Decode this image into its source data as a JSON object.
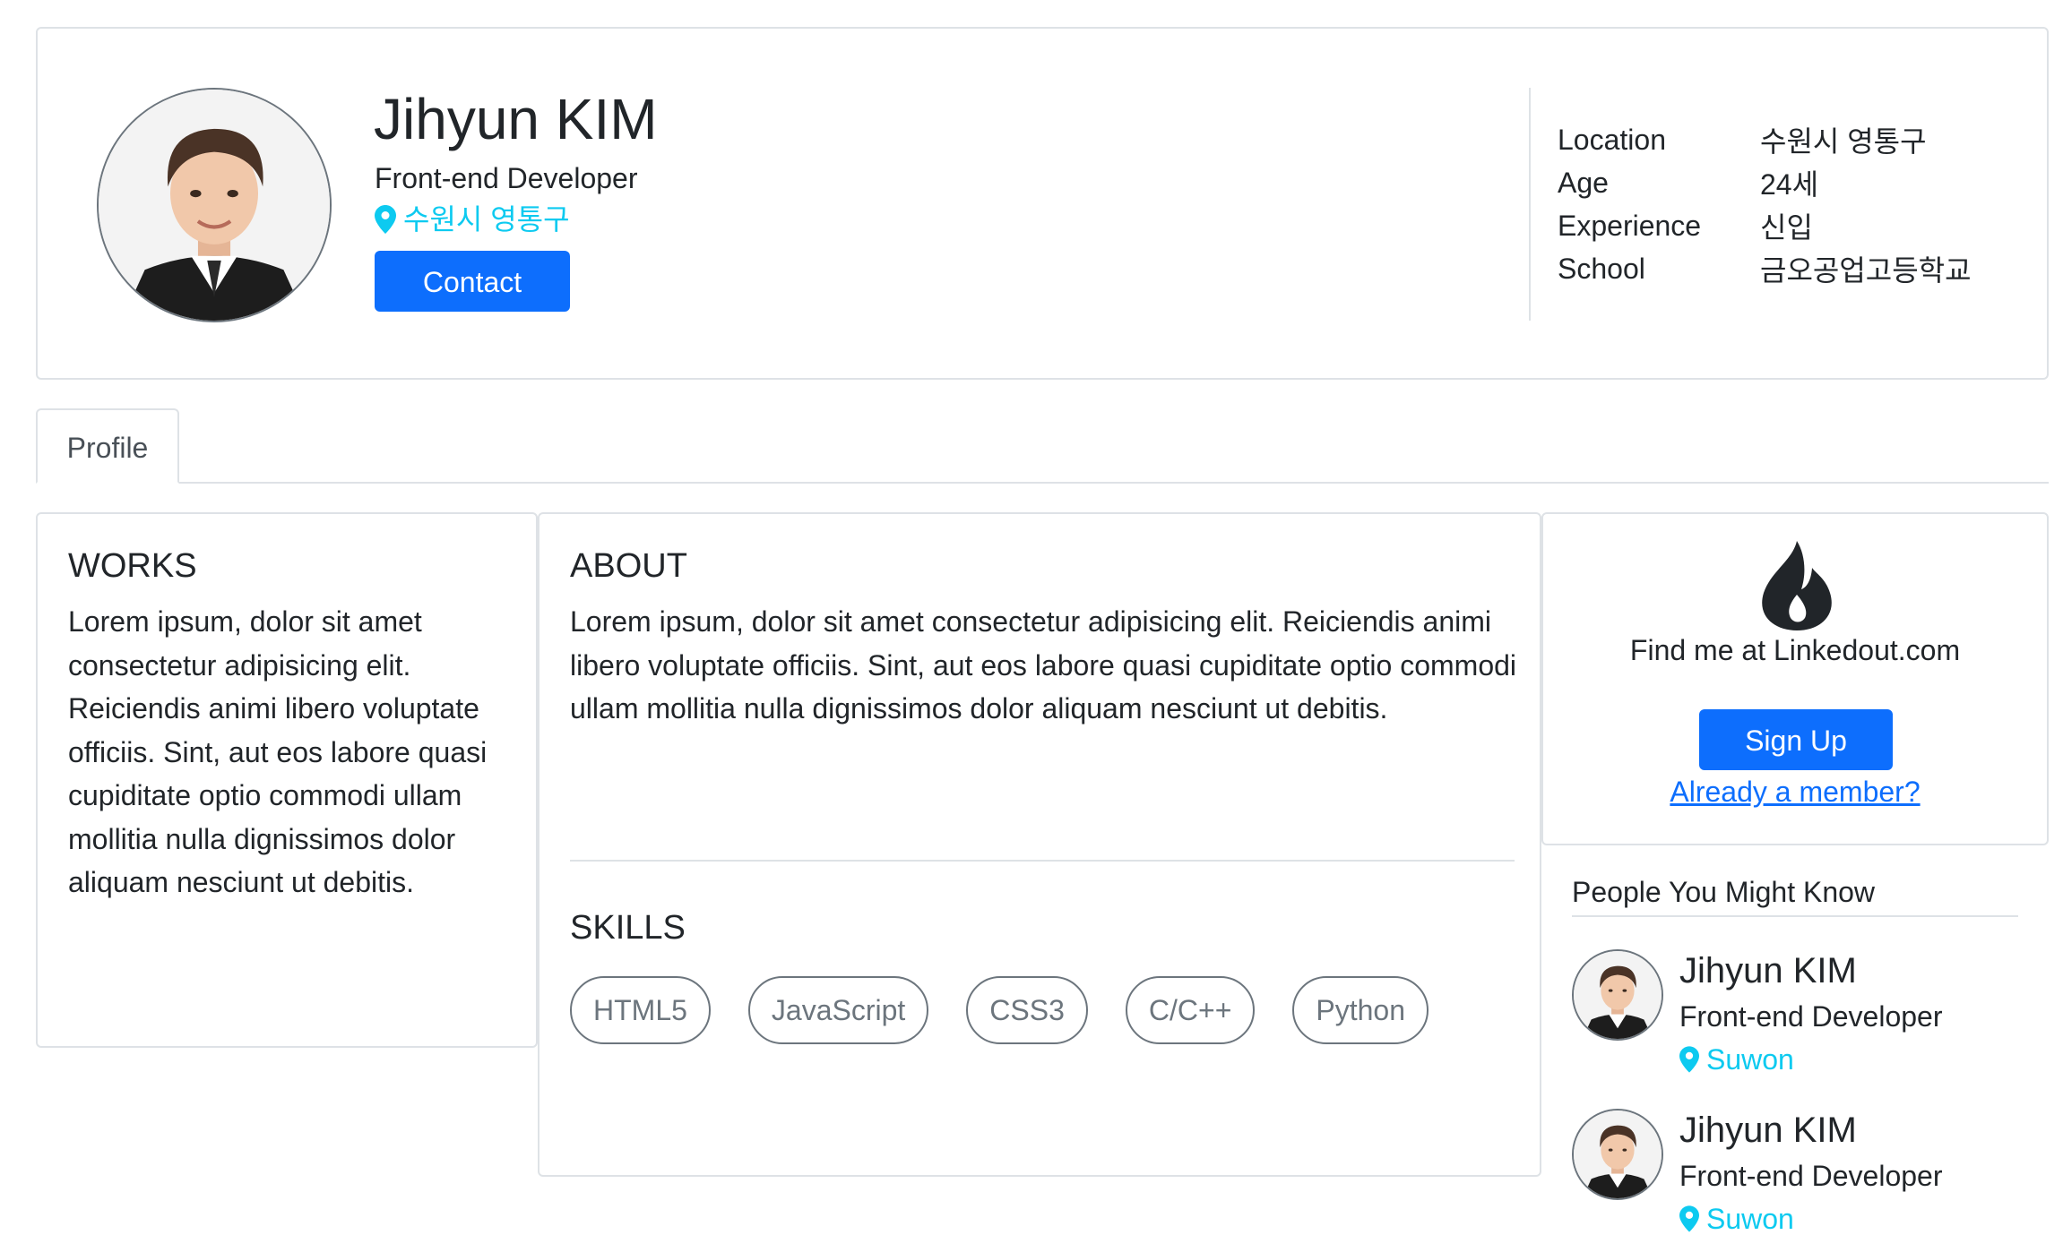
{
  "profile": {
    "name": "Jihyun KIM",
    "role": "Front-end Developer",
    "location": "수원시 영통구",
    "contact_label": "Contact",
    "avatar_icon": "portrait-photo"
  },
  "info": [
    {
      "key": "Location",
      "value": "수원시 영통구"
    },
    {
      "key": "Age",
      "value": "24세"
    },
    {
      "key": "Experience",
      "value": "신입"
    },
    {
      "key": "School",
      "value": "금오공업고등학교"
    }
  ],
  "tabs": [
    {
      "label": "Profile",
      "active": true
    }
  ],
  "works": {
    "title": "WORKS",
    "text": "Lorem ipsum, dolor sit amet consectetur adipisicing elit. Reiciendis animi libero voluptate officiis. Sint, aut eos labore quasi cupiditate optio commodi ullam mollitia nulla dignissimos dolor aliquam nesciunt ut debitis."
  },
  "about": {
    "title": "ABOUT",
    "text": "Lorem ipsum, dolor sit amet consectetur adipisicing elit. Reiciendis animi libero voluptate officiis. Sint, aut eos labore quasi cupiditate optio commodi ullam mollitia nulla dignissimos dolor aliquam nesciunt ut debitis."
  },
  "skills": {
    "title": "SKILLS",
    "items": [
      "HTML5",
      "JavaScript",
      "CSS3",
      "C/C++",
      "Python"
    ]
  },
  "signup": {
    "icon": "flame-icon",
    "text": "Find me at Linkedout.com",
    "button_label": "Sign Up",
    "link_label": "Already a member?"
  },
  "pymk": {
    "title": "People You Might Know",
    "people": [
      {
        "name": "Jihyun KIM",
        "role": "Front-end Developer",
        "location": "Suwon"
      },
      {
        "name": "Jihyun KIM",
        "role": "Front-end Developer",
        "location": "Suwon"
      }
    ]
  },
  "colors": {
    "primary": "#0d6efd",
    "info": "#0dcaf0",
    "border": "#dee2e6",
    "text": "#212529",
    "muted": "#6c757d"
  }
}
